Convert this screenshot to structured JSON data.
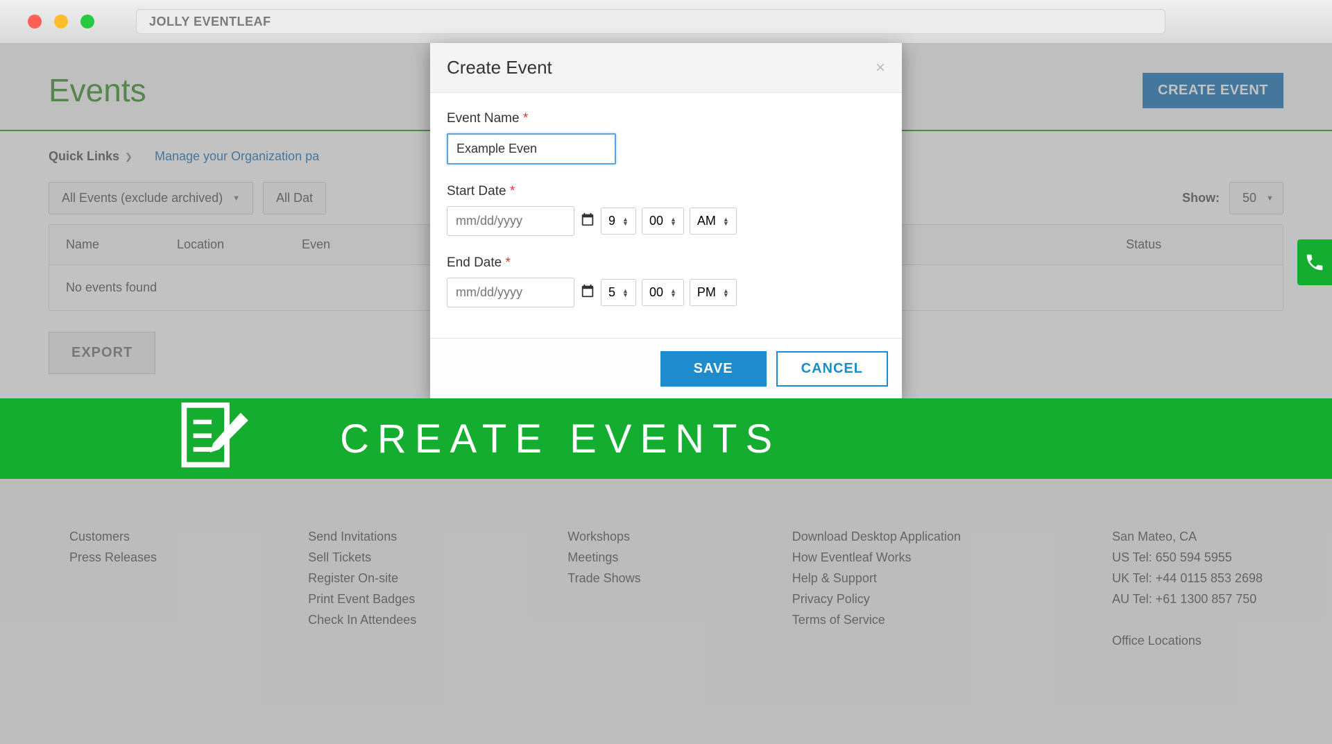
{
  "titlebar": {
    "url_text": "JOLLY EVENTLEAF"
  },
  "page": {
    "title": "Events",
    "create_button": "CREATE EVENT",
    "quick_links_label": "Quick Links",
    "manage_org_link": "Manage your Organization pa",
    "filters": {
      "events_filter": "All Events (exclude archived)",
      "dates_filter": "All Dat",
      "show_label": "Show:",
      "show_value": "50"
    },
    "table": {
      "headers": {
        "name": "Name",
        "location": "Location",
        "date": "Even",
        "status": "Status"
      },
      "empty": "No events found"
    },
    "export_button": "EXPORT"
  },
  "modal": {
    "title": "Create Event",
    "close": "×",
    "event_name_label": "Event Name",
    "event_name_value": "Example Even",
    "start_date_label": "Start Date",
    "end_date_label": "End Date",
    "date_placeholder": "mm/dd/yyyy",
    "start": {
      "hour": "9",
      "min": "00",
      "ampm": "AM"
    },
    "end": {
      "hour": "5",
      "min": "00",
      "ampm": "PM"
    },
    "save": "SAVE",
    "cancel": "CANCEL",
    "required": " *"
  },
  "banner": {
    "text": "CREATE EVENTS"
  },
  "footer": {
    "col1": [
      "Customers",
      "Press Releases"
    ],
    "col2": [
      "Send Invitations",
      "Sell Tickets",
      "Register On-site",
      "Print Event Badges",
      "Check In Attendees"
    ],
    "col3": [
      "Workshops",
      "Meetings",
      "Trade Shows"
    ],
    "col4": [
      "Download Desktop Application",
      "How Eventleaf Works",
      "Help & Support",
      "Privacy Policy",
      "Terms of Service"
    ],
    "col5": [
      "San Mateo, CA",
      "US Tel: 650 594 5955",
      "UK Tel: +44 0115 853 2698",
      "AU Tel: +61 1300 857 750",
      "",
      "Office Locations"
    ]
  }
}
